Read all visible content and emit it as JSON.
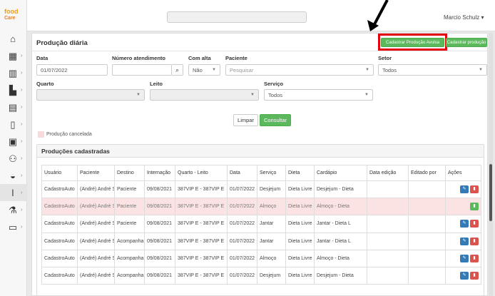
{
  "app": {
    "logo_line1": "food",
    "logo_line2": "Care"
  },
  "topbar": {
    "user": "Marcio Schulz ▾"
  },
  "sidebar": {
    "items": [
      {
        "icon": "home-icon",
        "glyph": "⌂"
      },
      {
        "icon": "grid-icon",
        "glyph": "▦"
      },
      {
        "icon": "building-icon",
        "glyph": "▥"
      },
      {
        "icon": "tools-icon",
        "glyph": "▙"
      },
      {
        "icon": "clipboard-icon",
        "glyph": "▤"
      },
      {
        "icon": "document-icon",
        "glyph": "▯"
      },
      {
        "icon": "box-icon",
        "glyph": "▣"
      },
      {
        "icon": "people-icon",
        "glyph": "⚇"
      },
      {
        "icon": "bowl-icon",
        "glyph": "◒"
      },
      {
        "icon": "utensils-icon",
        "glyph": "ǀ"
      },
      {
        "icon": "flask-icon",
        "glyph": "⚗"
      },
      {
        "icon": "monitor-icon",
        "glyph": "▭"
      }
    ]
  },
  "panel": {
    "title": "Produção diária",
    "btn_cadastrar_avulsa": "Cadastrar Produção Avulsa",
    "btn_cadastrar": "Cadastrar produção"
  },
  "filters": {
    "data_label": "Data",
    "data_value": "01/07/2022",
    "numero_label": "Número atendimento",
    "numero_value": "",
    "com_alta_label": "Com alta",
    "com_alta_value": "Não",
    "paciente_label": "Paciente",
    "paciente_placeholder": "Pesquisar",
    "setor_label": "Setor",
    "setor_value": "Todos",
    "quarto_label": "Quarto",
    "leito_label": "Leito",
    "servico_label": "Serviço",
    "servico_value": "Todos",
    "btn_limpar": "Limpar",
    "btn_consultar": "Consultar"
  },
  "legend": {
    "cancelada": "Produção cancelada"
  },
  "table": {
    "title": "Produções cadastradas",
    "headers": [
      "Usuário",
      "Paciente",
      "Destino",
      "Internação",
      "Quarto - Leito",
      "Data",
      "Serviço",
      "Dieta",
      "Cardápio",
      "Data edição",
      "Editado por",
      "Ações"
    ],
    "rows": [
      {
        "cells": [
          "CadastroAuto",
          "(André) André S",
          "Paciente",
          "09/08/2021",
          "387VIP E - 387VIP E",
          "01/07/2022",
          "Desjejum",
          "Dieta Livre",
          "Desjejum - Dieta",
          "",
          ""
        ],
        "cancelled": false
      },
      {
        "cells": [
          "CadastroAuto",
          "(André) André S",
          "Paciente",
          "09/08/2021",
          "387VIP E - 387VIP E",
          "01/07/2022",
          "Almoço",
          "Dieta Livre",
          "Almoço - Dieta",
          "",
          ""
        ],
        "cancelled": true
      },
      {
        "cells": [
          "CadastroAuto",
          "(André) André S",
          "Paciente",
          "09/08/2021",
          "387VIP E - 387VIP E",
          "01/07/2022",
          "Jantar",
          "Dieta Livre",
          "Jantar - Dieta L",
          "",
          ""
        ],
        "cancelled": false
      },
      {
        "cells": [
          "CadastroAuto",
          "(André) André S",
          "Acompanha",
          "09/08/2021",
          "387VIP E - 387VIP E",
          "01/07/2022",
          "Jantar",
          "Dieta Livre",
          "Jantar - Dieta L",
          "",
          ""
        ],
        "cancelled": false
      },
      {
        "cells": [
          "CadastroAuto",
          "(André) André S",
          "Acompanha",
          "09/08/2021",
          "387VIP E - 387VIP E",
          "01/07/2022",
          "Almoço",
          "Dieta Livre",
          "Almoço - Dieta",
          "",
          ""
        ],
        "cancelled": false
      },
      {
        "cells": [
          "CadastroAuto",
          "(André) André S",
          "Acompanha",
          "09/08/2021",
          "387VIP E - 387VIP E",
          "01/07/2022",
          "Desjejum",
          "Dieta Livre",
          "Desjejum - Dieta",
          "",
          ""
        ],
        "cancelled": false
      }
    ]
  },
  "colors": {
    "accent_green": "#5cb85c",
    "highlight_red": "#e3000f",
    "edit_blue": "#337ab7",
    "delete_red": "#d9534f",
    "cancel_row": "#fbe3e3"
  }
}
